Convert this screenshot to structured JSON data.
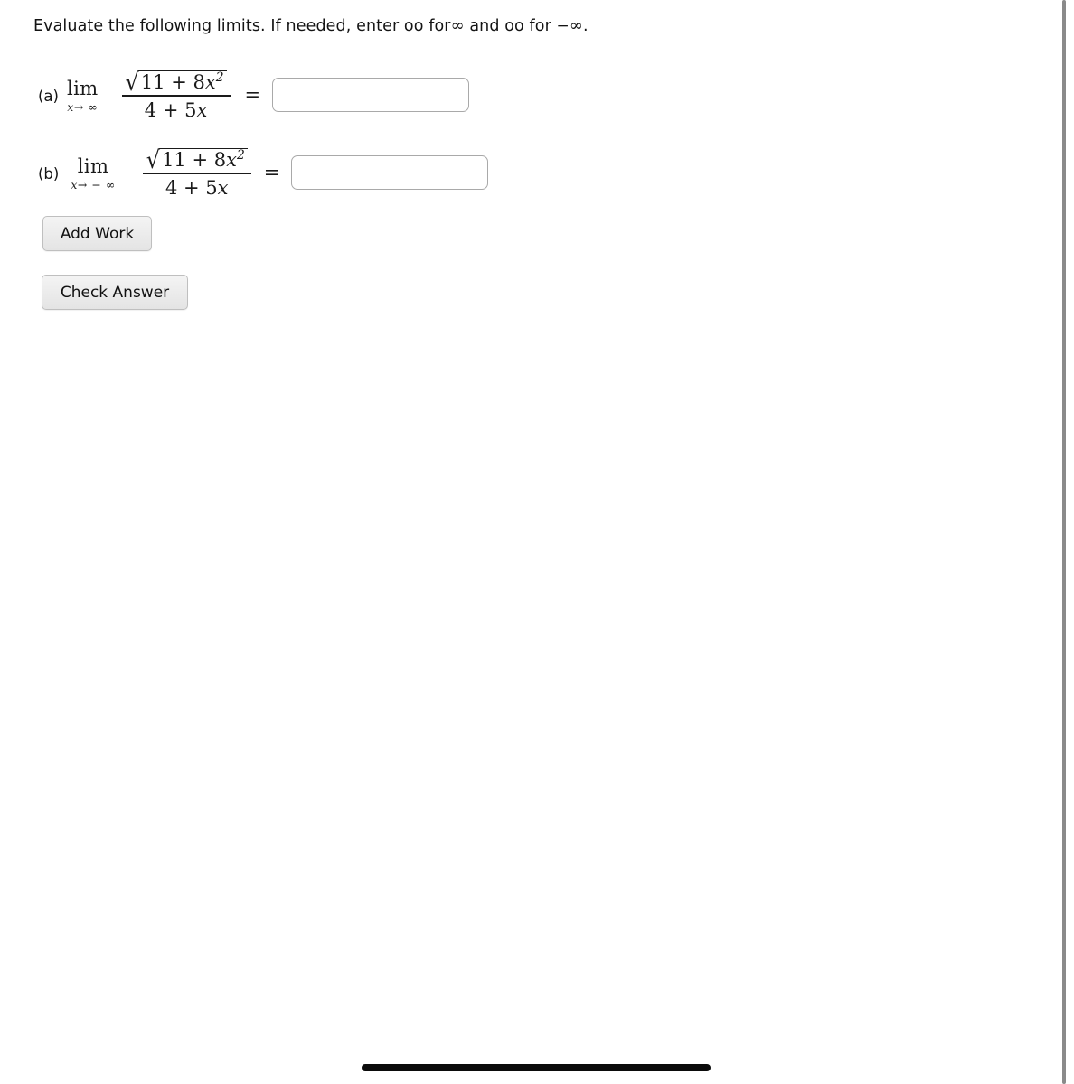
{
  "page": {
    "prompt_before": "Evaluate the following limits. If needed, enter oo for",
    "prompt_infinity": "∞",
    "prompt_middle": "and oo for",
    "prompt_minus": "−",
    "prompt_infinity2": "∞",
    "prompt_period": "."
  },
  "problems": [
    {
      "label": "(a)",
      "lim": "lim",
      "sub_var": "x",
      "sub_arrow": "→",
      "sub_target": "∞",
      "sub_full": "x → ∞",
      "numerator_radical_sign": "√",
      "numerator_radicand_lead": "11 + 8",
      "numerator_radicand_var": "x",
      "numerator_radicand_exp": "2",
      "numerator_text": "√(11 + 8x²)",
      "denominator_lead": "4 + 5",
      "denominator_var": "x",
      "denominator_text": "4 + 5x",
      "equals": "=",
      "answer_value": "",
      "answer_placeholder": ""
    },
    {
      "label": "(b)",
      "lim": "lim",
      "sub_var": "x",
      "sub_arrow": "→",
      "sub_target": "− ∞",
      "sub_full": "x → − ∞",
      "numerator_radical_sign": "√",
      "numerator_radicand_lead": "11 + 8",
      "numerator_radicand_var": "x",
      "numerator_radicand_exp": "2",
      "numerator_text": "√(11 + 8x²)",
      "denominator_lead": "4 + 5",
      "denominator_var": "x",
      "denominator_text": "4 + 5x",
      "equals": "=",
      "answer_value": "",
      "answer_placeholder": ""
    }
  ],
  "buttons": {
    "add_work": "Add Work",
    "check_answer": "Check Answer"
  },
  "colors": {
    "page_background": "#ffffff",
    "text": "#141414",
    "input_border": "#a9a9a9",
    "button_face": "#ececec",
    "button_border": "#bfbfbf",
    "scrollbar_vertical": "#8a8a8a",
    "scrollbar_horizontal": "#0b0b0b"
  }
}
